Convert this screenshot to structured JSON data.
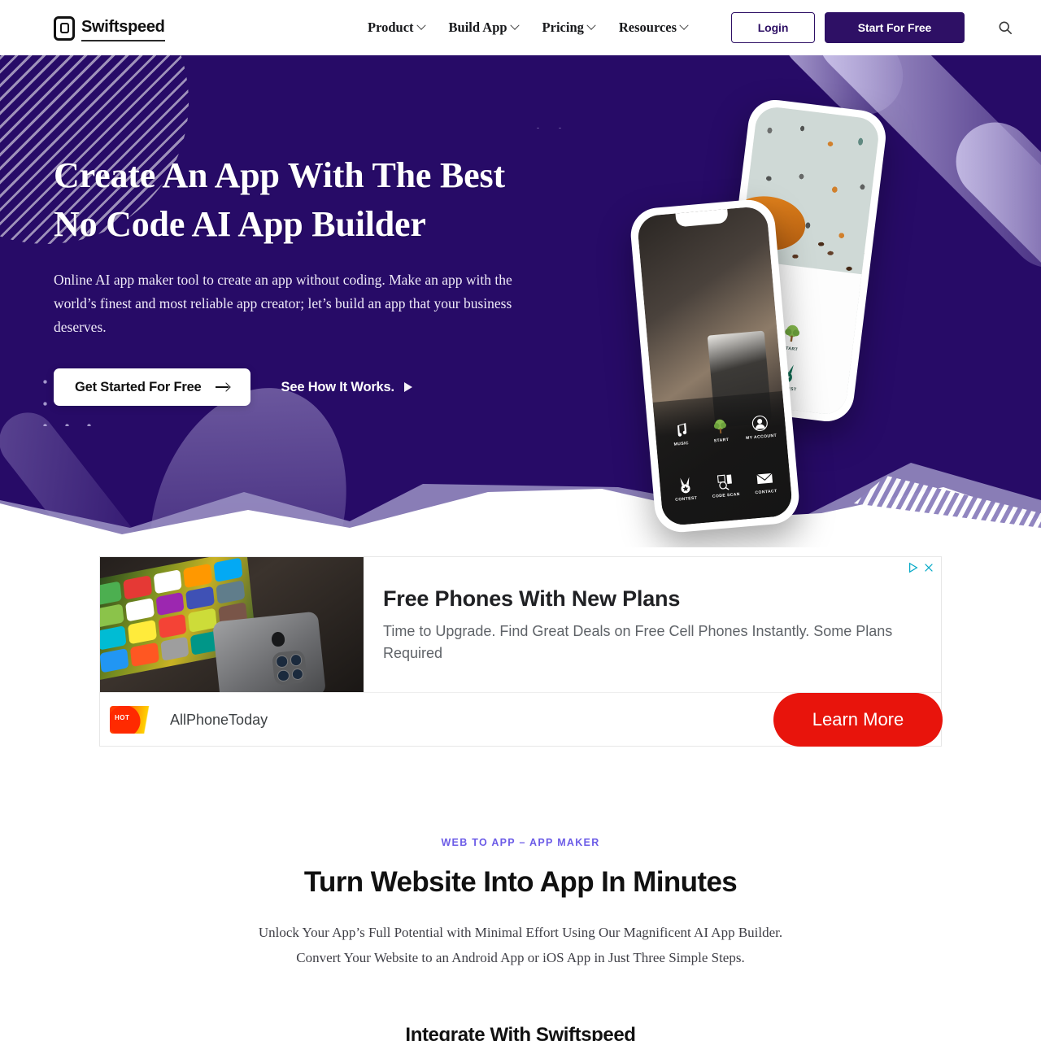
{
  "brand": {
    "name": "Swiftspeed",
    "logo_icon": "app-phone-logo-icon"
  },
  "nav": {
    "items": [
      {
        "label": "Product",
        "caret": true
      },
      {
        "label": "Build App",
        "caret": true
      },
      {
        "label": "Pricing",
        "caret": true
      },
      {
        "label": "Resources",
        "caret": true
      }
    ],
    "login_label": "Login",
    "start_label": "Start For Free",
    "search_icon": "search-icon"
  },
  "hero": {
    "title_line1": "Create An App With The Best",
    "title_line2": "No Code AI App Builder",
    "subtitle": "Online AI app maker tool to create an app without coding. Make an app with the world’s finest and most reliable app creator; let’s build an app that your business deserves.",
    "cta_primary": "Get Started For Free",
    "cta_secondary": "See How It Works.",
    "bg_color": "#270b67",
    "phone_back_menu": [
      {
        "icon": "tree-icon",
        "label": "START"
      },
      {
        "icon": "medal-icon",
        "label": "CONTEST"
      }
    ],
    "phone_front_menu": [
      {
        "icon": "music-note-icon",
        "label": "MUSIC"
      },
      {
        "icon": "tree-icon",
        "label": "START"
      },
      {
        "icon": "account-icon",
        "label": "MY ACCOUNT"
      },
      {
        "icon": "medal-icon",
        "label": "CONTEST"
      },
      {
        "icon": "code-scan-icon",
        "label": "CODE SCAN"
      },
      {
        "icon": "envelope-icon",
        "label": "CONTACT"
      }
    ]
  },
  "ad": {
    "headline": "Free Phones With New Plans",
    "description": "Time to Upgrade. Find Great Deals on Free Cell Phones Instantly. Some Plans Required",
    "advertiser": "AllPhoneToday",
    "cta_label": "Learn More",
    "cta_color": "#e8140c",
    "adchoices_icon": "adchoices-icon",
    "close_icon": "close-icon"
  },
  "section": {
    "eyebrow": "WEB TO APP – APP MAKER",
    "eyebrow_color": "#6c5ce7",
    "title": "Turn Website Into App In Minutes",
    "description": "Unlock Your App’s Full Potential with Minimal Effort Using Our Magnificent AI App Builder. Convert Your Website to an Android App or iOS App in Just Three Simple Steps.",
    "subtitle": "Integrate With Swiftspeed"
  }
}
